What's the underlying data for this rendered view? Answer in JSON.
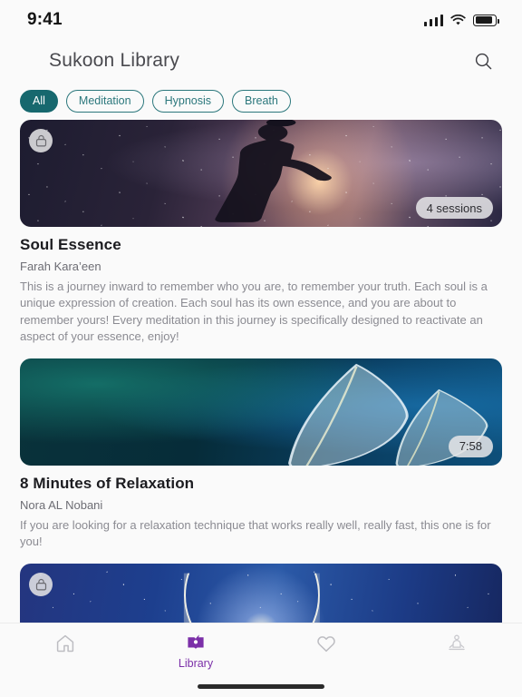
{
  "status_bar": {
    "time": "9:41",
    "signal_icon": "cellular-signal-icon",
    "wifi_icon": "wifi-icon",
    "battery_icon": "battery-icon"
  },
  "header": {
    "title": "Sukoon Library",
    "search_icon": "search-icon"
  },
  "filters": {
    "chips": [
      {
        "label": "All",
        "active": true
      },
      {
        "label": "Meditation",
        "active": false
      },
      {
        "label": "Hypnosis",
        "active": false
      },
      {
        "label": "Breath",
        "active": false
      }
    ],
    "active_color": "#17686e",
    "outline_color": "#2b777c"
  },
  "library": {
    "cards": [
      {
        "title": "Soul Essence",
        "author": "Farah Kara’een",
        "description": "This is a journey inward to remember who you are, to remember your truth. Each soul is a unique expression of creation. Each soul has its own essence, and you are about to remember yours! Every meditation in this journey is specifically designed to reactivate an aspect of your essence, enjoy!",
        "badge": "4 sessions",
        "locked": true,
        "lock_icon": "lock-icon",
        "artwork": "woman-silhouette-starry-sky"
      },
      {
        "title": "8 Minutes of Relaxation",
        "author": "Nora AL Nobani",
        "description": "If you are looking for a relaxation technique that works really well, really fast, this one is for you!",
        "badge": "7:58",
        "locked": false,
        "lock_icon": "lock-icon",
        "artwork": "skeleton-leaves-teal"
      },
      {
        "title": "",
        "author": "",
        "description": "",
        "badge": "",
        "locked": true,
        "lock_icon": "lock-icon",
        "artwork": "crescent-moon-starry-sky"
      }
    ]
  },
  "tabbar": {
    "active_color": "#7b2fa8",
    "inactive_color": "#bdbdc2",
    "items": [
      {
        "label": "",
        "icon": "home-icon",
        "active": false
      },
      {
        "label": "Library",
        "icon": "book-icon",
        "active": true
      },
      {
        "label": "",
        "icon": "heart-icon",
        "active": false
      },
      {
        "label": "",
        "icon": "meditation-icon",
        "active": false
      }
    ]
  }
}
